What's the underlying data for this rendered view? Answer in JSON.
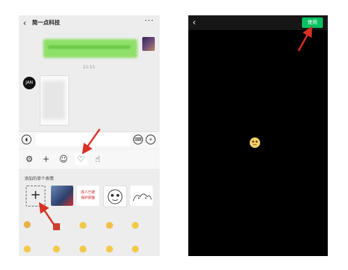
{
  "left_screen": {
    "header": {
      "back_glyph": "‹",
      "title": "简一点科技",
      "more_glyph": "···"
    },
    "chat": {
      "timestamp": "21:51",
      "left_avatar_text": "JAN"
    },
    "input_bar": {
      "voice_glyph": "◖",
      "keyboard_glyph": "⌨",
      "plus_glyph": "+"
    },
    "toolbar": {
      "settings_glyph": "⚙",
      "add_glyph": "+",
      "emoji_glyph": "☺",
      "favorite_glyph": "♡",
      "gesture_glyph": "☝"
    },
    "sticker_panel": {
      "title": "添加的单个表情",
      "add_glyph": "+",
      "thumb_text_3": "成人已被\n保护那猫"
    }
  },
  "right_screen": {
    "back_glyph": "‹",
    "use_button_label": "使用"
  },
  "colors": {
    "wechat_green": "#07c160",
    "bubble_green": "#8fe069",
    "annotation_red": "#d93025",
    "panel_bg": "#ededed"
  }
}
